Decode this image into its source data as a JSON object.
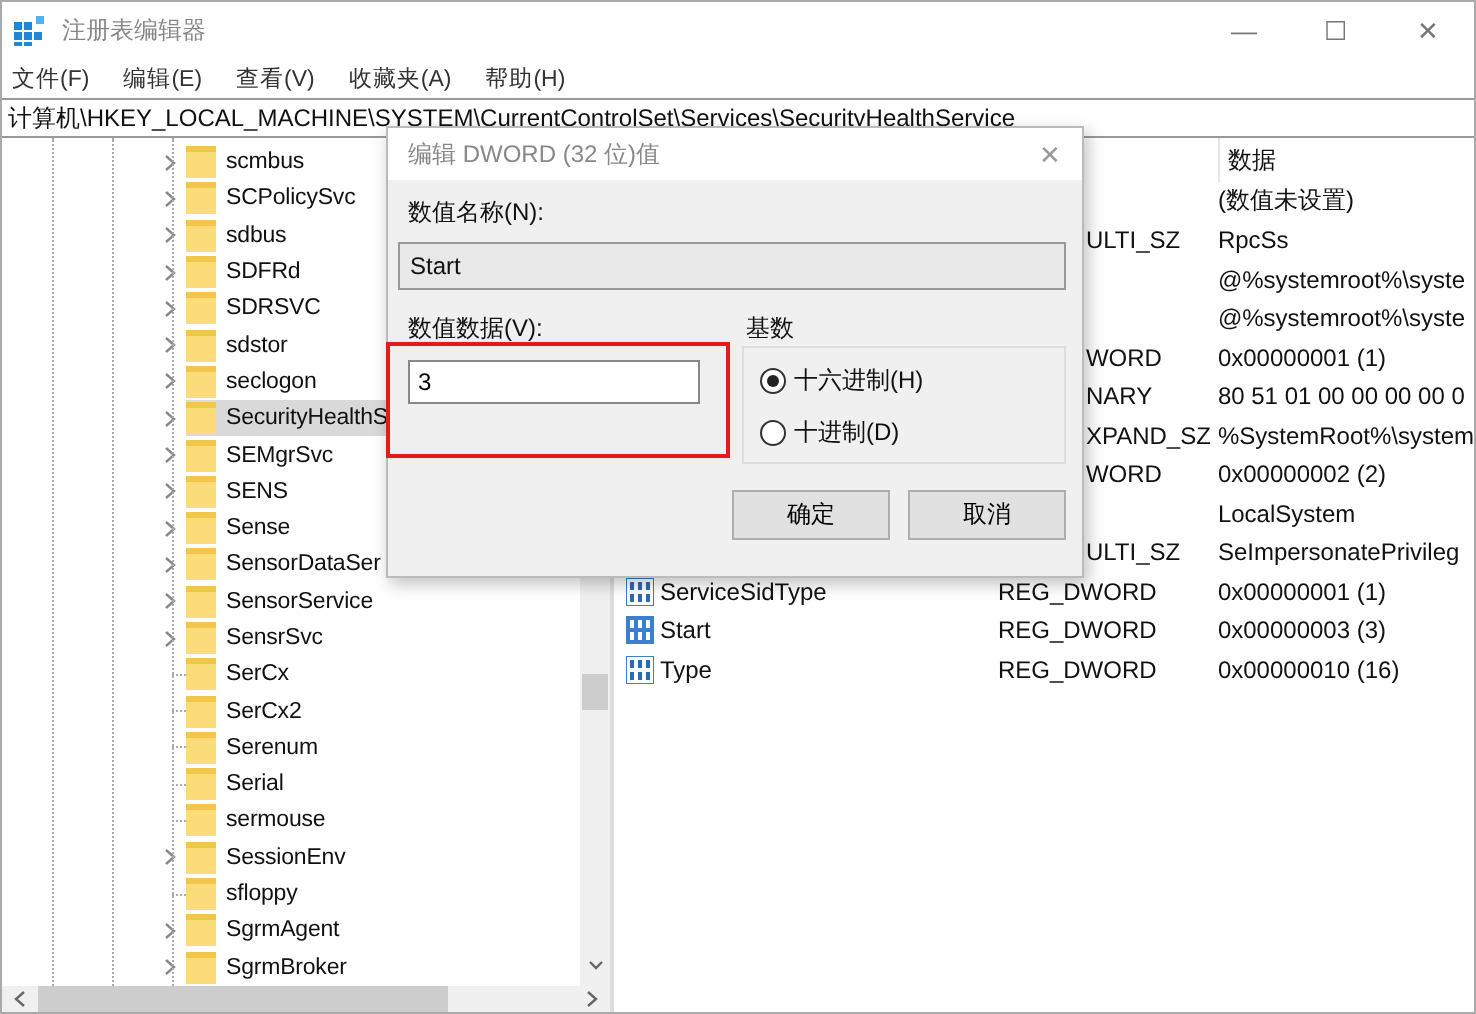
{
  "window": {
    "title": "注册表编辑器",
    "controls": [
      "—",
      "☐",
      "✕"
    ]
  },
  "menu": [
    "文件(F)",
    "编辑(E)",
    "查看(V)",
    "收藏夹(A)",
    "帮助(H)"
  ],
  "address": "计算机\\HKEY_LOCAL_MACHINE\\SYSTEM\\CurrentControlSet\\Services\\SecurityHealthService",
  "tree": [
    {
      "label": "scmbus",
      "has_children": true,
      "selected": false
    },
    {
      "label": "SCPolicySvc",
      "has_children": true,
      "selected": false
    },
    {
      "label": "sdbus",
      "has_children": true,
      "selected": false
    },
    {
      "label": "SDFRd",
      "has_children": true,
      "selected": false
    },
    {
      "label": "SDRSVC",
      "has_children": true,
      "selected": false
    },
    {
      "label": "sdstor",
      "has_children": true,
      "selected": false
    },
    {
      "label": "seclogon",
      "has_children": true,
      "selected": false
    },
    {
      "label": "SecurityHealthS",
      "has_children": true,
      "selected": true
    },
    {
      "label": "SEMgrSvc",
      "has_children": true,
      "selected": false
    },
    {
      "label": "SENS",
      "has_children": true,
      "selected": false
    },
    {
      "label": "Sense",
      "has_children": true,
      "selected": false
    },
    {
      "label": "SensorDataSer",
      "has_children": true,
      "selected": false
    },
    {
      "label": "SensorService",
      "has_children": true,
      "selected": false
    },
    {
      "label": "SensrSvc",
      "has_children": true,
      "selected": false
    },
    {
      "label": "SerCx",
      "has_children": false,
      "selected": false
    },
    {
      "label": "SerCx2",
      "has_children": false,
      "selected": false
    },
    {
      "label": "Serenum",
      "has_children": false,
      "selected": false
    },
    {
      "label": "Serial",
      "has_children": false,
      "selected": false
    },
    {
      "label": "sermouse",
      "has_children": false,
      "selected": false
    },
    {
      "label": "SessionEnv",
      "has_children": true,
      "selected": false
    },
    {
      "label": "sfloppy",
      "has_children": false,
      "selected": false
    },
    {
      "label": "SgrmAgent",
      "has_children": true,
      "selected": false
    },
    {
      "label": "SgrmBroker",
      "has_children": true,
      "selected": false
    }
  ],
  "values": {
    "data_header": "数据",
    "rows": [
      {
        "data": "(数值未设置)"
      },
      {
        "type": "ULTI_SZ",
        "data": "RpcSs"
      },
      {
        "data": "@%systemroot%\\syste"
      },
      {
        "data": "@%systemroot%\\syste"
      },
      {
        "type": "WORD",
        "data": "0x00000001 (1)"
      },
      {
        "type": "NARY",
        "data": "80 51 01 00 00 00 00 0"
      },
      {
        "type": "XPAND_SZ",
        "data": "%SystemRoot%\\system"
      },
      {
        "type": "WORD",
        "data": "0x00000002 (2)"
      },
      {
        "data": "LocalSystem"
      },
      {
        "type": "ULTI_SZ",
        "data": "SeImpersonatePrivileg"
      },
      {
        "name": "ServiceSidType",
        "type": "REG_DWORD",
        "data": "0x00000001 (1)",
        "selected": false
      },
      {
        "name": "Start",
        "type": "REG_DWORD",
        "data": "0x00000003 (3)",
        "selected": true
      },
      {
        "name": "Type",
        "type": "REG_DWORD",
        "data": "0x00000010 (16)",
        "selected": false
      }
    ]
  },
  "dialog": {
    "title": "编辑 DWORD (32 位)值",
    "close": "✕",
    "name_label": "数值名称(N):",
    "name_value": "Start",
    "data_label": "数值数据(V):",
    "data_value": "3",
    "base_label": "基数",
    "bases": [
      {
        "label": "十六进制(H)",
        "selected": true
      },
      {
        "label": "十进制(D)",
        "selected": false
      }
    ],
    "buttons": [
      "确定",
      "取消"
    ]
  }
}
